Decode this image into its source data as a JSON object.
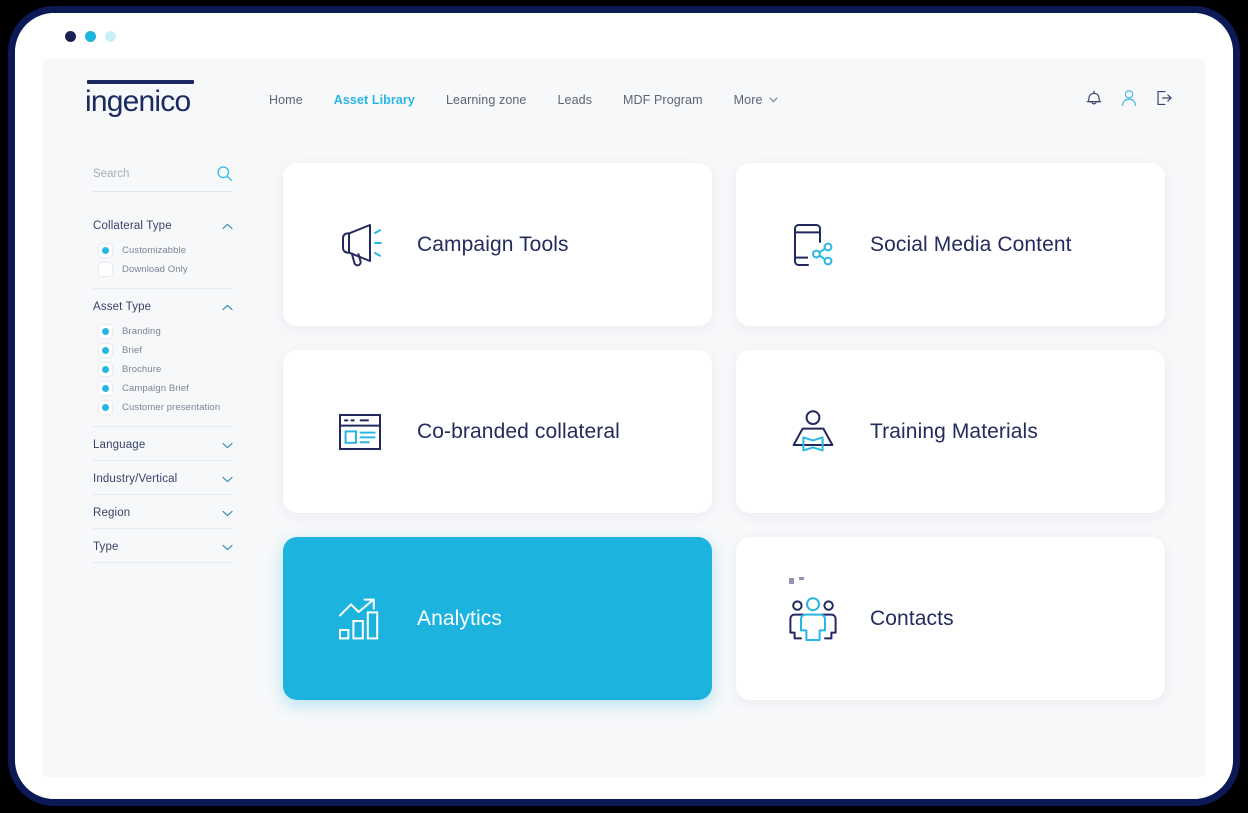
{
  "theme": {
    "accent_cyan": "#1cb4de",
    "navy": "#1b2a63",
    "frame_navy": "#0b1a55",
    "page_bg": "#f7f8fa",
    "card_bg": "#ffffff",
    "muted_text": "#5b6477"
  },
  "window": {
    "traffic_lights": [
      {
        "name": "close-dot",
        "color": "#1a2254"
      },
      {
        "name": "minimize-dot",
        "color": "#1cb4de"
      },
      {
        "name": "maximize-dot",
        "color": "#c9eef8"
      }
    ]
  },
  "header": {
    "logo": {
      "text": "ingenico"
    },
    "nav": [
      {
        "label": "Home",
        "active": false,
        "caret": false
      },
      {
        "label": "Asset Library",
        "active": true,
        "caret": false
      },
      {
        "label": "Learning zone",
        "active": false,
        "caret": false
      },
      {
        "label": "Leads",
        "active": false,
        "caret": false
      },
      {
        "label": "MDF Program",
        "active": false,
        "caret": false
      },
      {
        "label": "More",
        "active": false,
        "caret": true
      }
    ],
    "icons": [
      {
        "name": "notification-bell-icon",
        "color": "#3a4370"
      },
      {
        "name": "user-profile-icon",
        "color": "#49b7e0"
      },
      {
        "name": "logout-icon",
        "color": "#3a4370"
      }
    ]
  },
  "sidebar": {
    "search": {
      "placeholder": "Search",
      "value": ""
    },
    "filters": [
      {
        "title": "Collateral Type",
        "expanded": true,
        "chevron": "chevron-up-icon",
        "options": [
          {
            "label": "Customizabble",
            "checked": true
          },
          {
            "label": "Download Only",
            "checked": false
          }
        ]
      },
      {
        "title": "Asset Type",
        "expanded": true,
        "chevron": "chevron-up-icon",
        "options": [
          {
            "label": "Branding",
            "checked": true
          },
          {
            "label": "Brief",
            "checked": true
          },
          {
            "label": "Brochure",
            "checked": true
          },
          {
            "label": "Campaign Brief",
            "checked": true
          },
          {
            "label": "Customer presentation",
            "checked": true
          }
        ]
      },
      {
        "title": "Language",
        "expanded": false,
        "chevron": "chevron-down-icon",
        "options": []
      },
      {
        "title": "Industry/Vertical",
        "expanded": false,
        "chevron": "chevron-down-icon",
        "options": []
      },
      {
        "title": "Region",
        "expanded": false,
        "chevron": "chevron-down-icon",
        "options": []
      },
      {
        "title": "Type",
        "expanded": false,
        "chevron": "chevron-down-icon",
        "options": []
      }
    ]
  },
  "main": {
    "tiles": [
      {
        "label": "Campaign Tools",
        "icon": "megaphone-icon",
        "selected": false
      },
      {
        "label": "Social Media Content",
        "icon": "mobile-share-icon",
        "selected": false
      },
      {
        "label": "Co-branded collateral",
        "icon": "browser-window-icon",
        "selected": false
      },
      {
        "label": "Training Materials",
        "icon": "person-reading-icon",
        "selected": false
      },
      {
        "label": "Analytics",
        "icon": "bar-chart-growth-icon",
        "selected": true
      },
      {
        "label": "Contacts",
        "icon": "people-group-icon",
        "selected": false
      }
    ]
  }
}
